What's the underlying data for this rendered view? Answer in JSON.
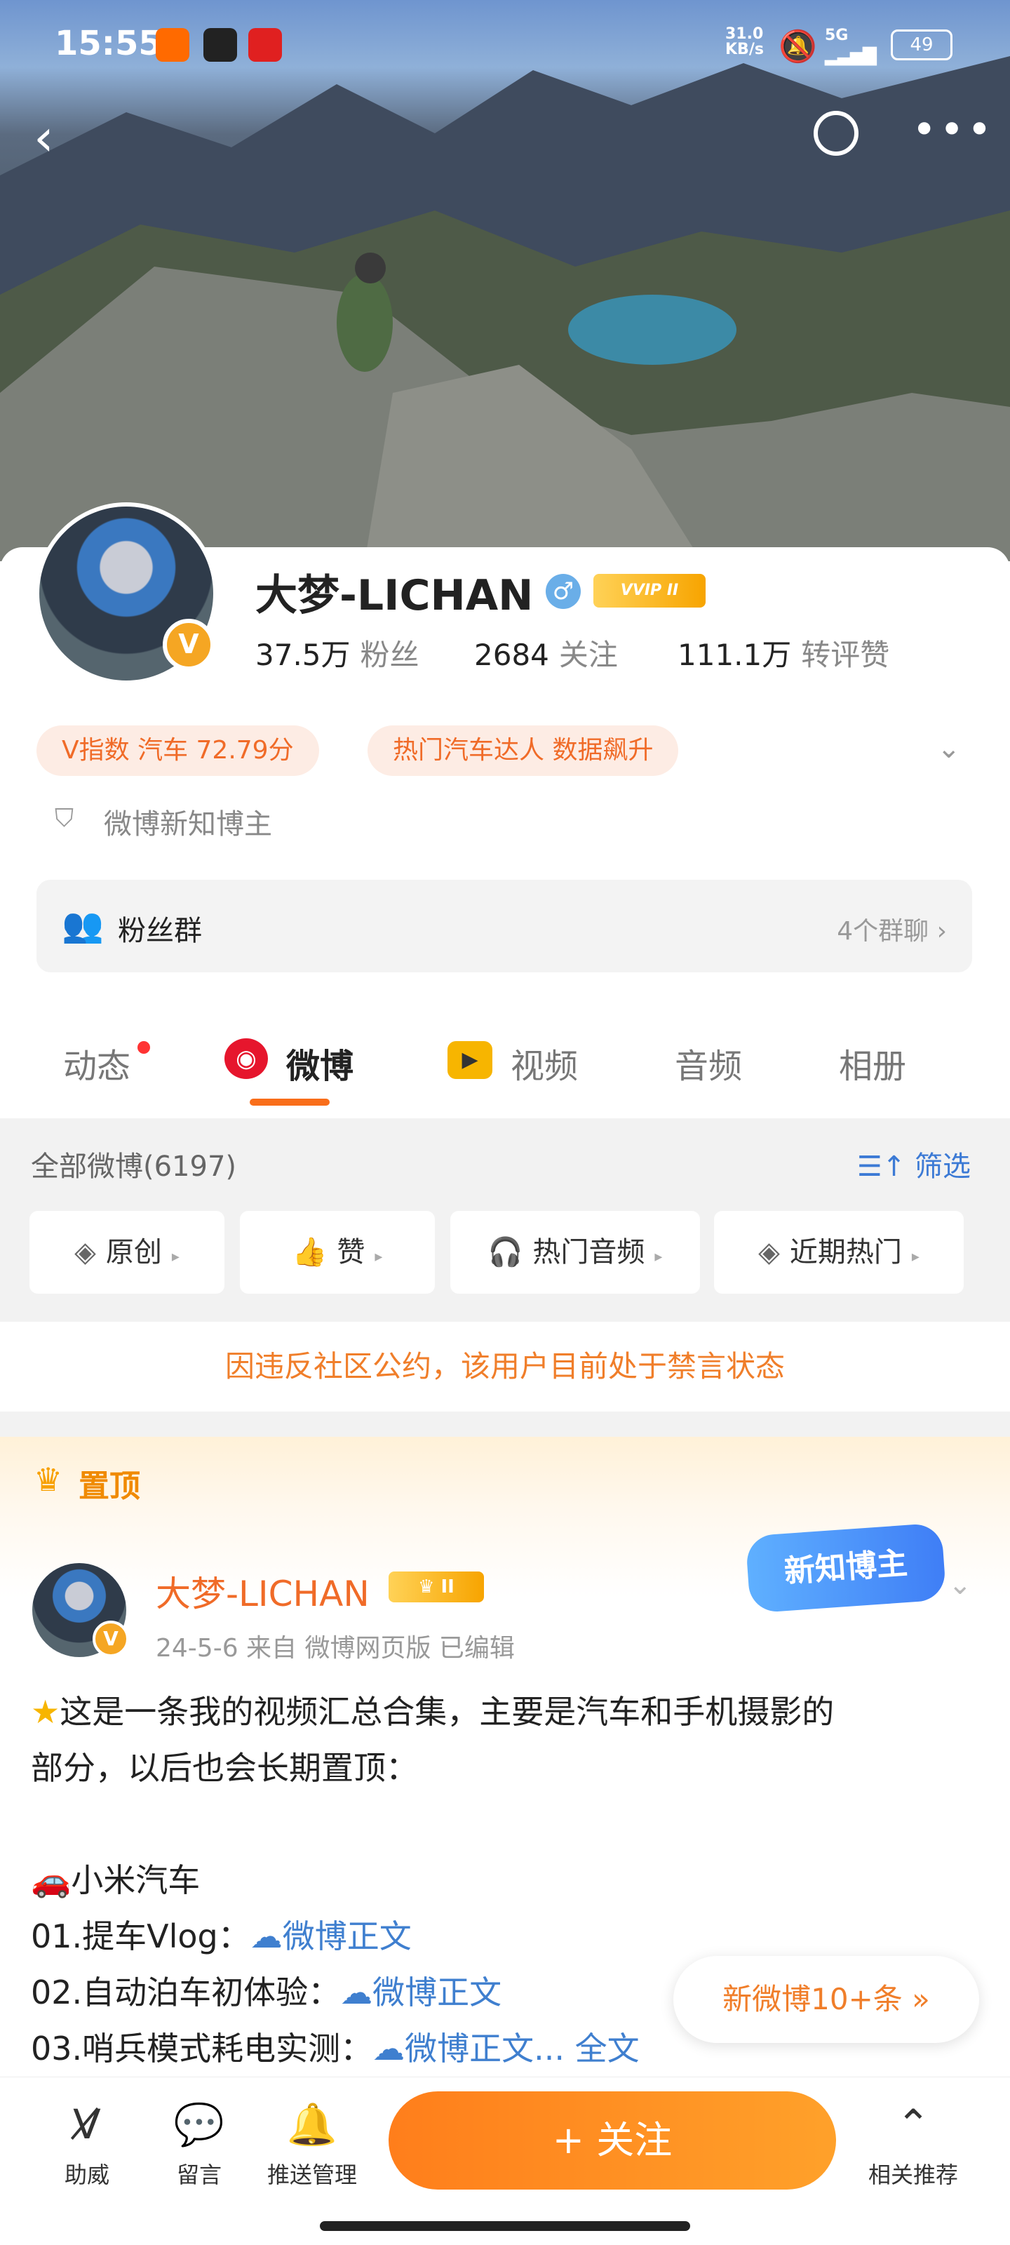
{
  "status_bar": {
    "time": "15:55",
    "network_speed": "31.0\nKB/s",
    "signal": "5G",
    "battery": "49"
  },
  "profile": {
    "name": "大梦-LICHAN",
    "vip_badge": "VVIP II",
    "fans_count": "37.5万",
    "fans_label": "粉丝",
    "following_count": "2684",
    "following_label": "关注",
    "reposts_count": "111.1万",
    "reposts_label": "转评赞",
    "tags": [
      "V指数 汽车 72.79分",
      "热门汽车达人 数据飙升"
    ],
    "certification": "微博新知博主",
    "fan_group_label": "粉丝群",
    "fan_group_count": "4个群聊"
  },
  "tabs": [
    {
      "label": "动态",
      "has_dot": true
    },
    {
      "label": "微博",
      "active": true
    },
    {
      "label": "视频"
    },
    {
      "label": "音频"
    },
    {
      "label": "相册"
    }
  ],
  "filter": {
    "all_label": "全部微博(6197)",
    "filter_label": "筛选",
    "chips": [
      "原创",
      "赞",
      "热门音频",
      "近期热门"
    ]
  },
  "notice": "因违反社区公约，该用户目前处于禁言状态",
  "post": {
    "pin_label": "置顶",
    "new_zhi_badge": "新知博主",
    "author": "大梦-LICHAN",
    "meta": "24-5-6  来自 微博网页版  已编辑",
    "line1": "这是一条我的视频汇总合集，主要是汽车和手机摄影的",
    "line2": "部分，以后也会长期置顶：",
    "section_title": "小米汽车",
    "item1_prefix": "01.提车Vlog：",
    "item2_prefix": "02.自动泊车初体验：",
    "item3_prefix": "03.哨兵模式耗电实测：",
    "link_text": "微博正文",
    "link_text_ellipsis": "微博正文...",
    "full_text": "全文"
  },
  "new_posts_button": "新微博10+条",
  "bottom_bar": {
    "help": "助威",
    "message": "留言",
    "push": "推送管理",
    "follow": "+ 关注",
    "related": "相关推荐"
  }
}
